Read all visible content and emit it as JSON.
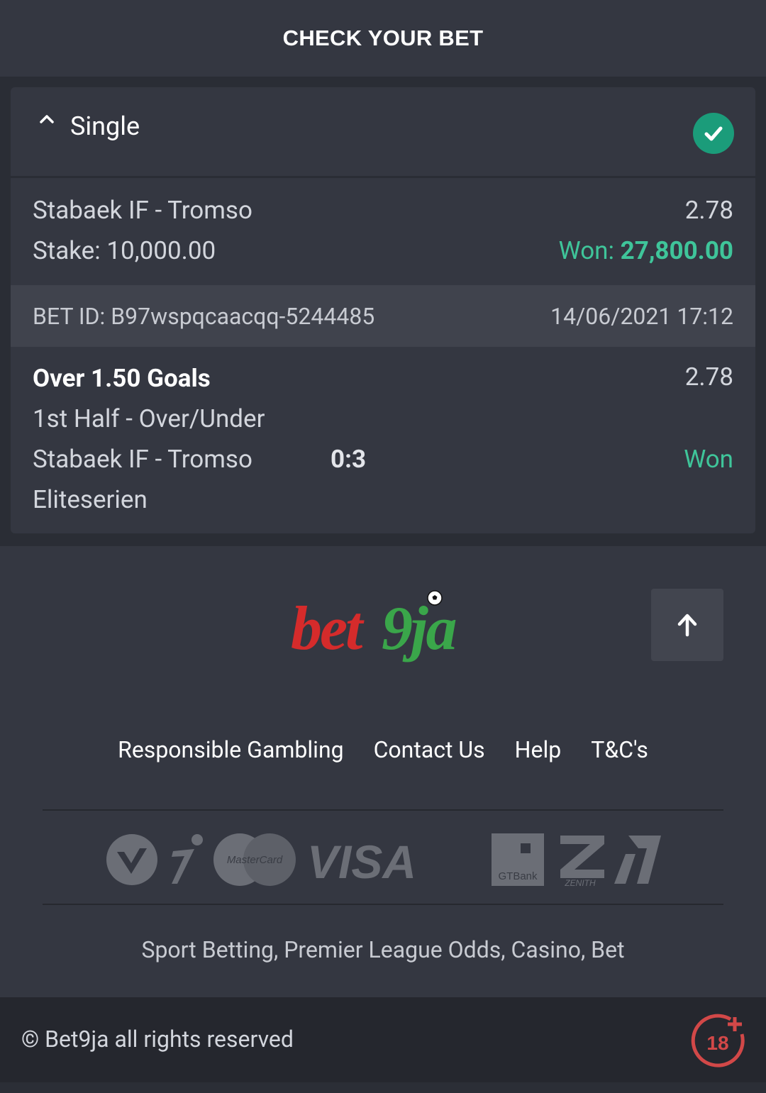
{
  "header": {
    "title": "CHECK YOUR BET"
  },
  "bet": {
    "type_label": "Single",
    "match": "Stabaek IF - Tromso",
    "total_odds": "2.78",
    "stake_label": "Stake: 10,000.00",
    "won_label": "Won:",
    "won_amount": "27,800.00",
    "bet_id": "BET ID: B97wspqcaacqq-5244485",
    "datetime": "14/06/2021 17:12"
  },
  "selection": {
    "title": "Over 1.50 Goals",
    "odds": "2.78",
    "market": "1st Half - Over/Under",
    "match": "Stabaek IF - Tromso",
    "score": "0:3",
    "status": "Won",
    "league": "Eliteserien"
  },
  "footer": {
    "logo_parts": [
      "bet",
      "9ja"
    ],
    "links": [
      "Responsible Gambling",
      "Contact Us",
      "Help",
      "T&C's"
    ],
    "payment_logos": [
      "Verve",
      "interswitch",
      "MasterCard",
      "VISA",
      "GTBank",
      "ZENITH",
      "Stanbic"
    ],
    "tagline": "Sport Betting, Premier League Odds, Casino, Bet",
    "copyright": "© Bet9ja all rights reserved",
    "age_badge": "18"
  },
  "colors": {
    "accent_green": "#3fc59a",
    "check_green": "#1b9c7a",
    "brand_red": "#d52b2b",
    "brand_green": "#3aa64a"
  }
}
